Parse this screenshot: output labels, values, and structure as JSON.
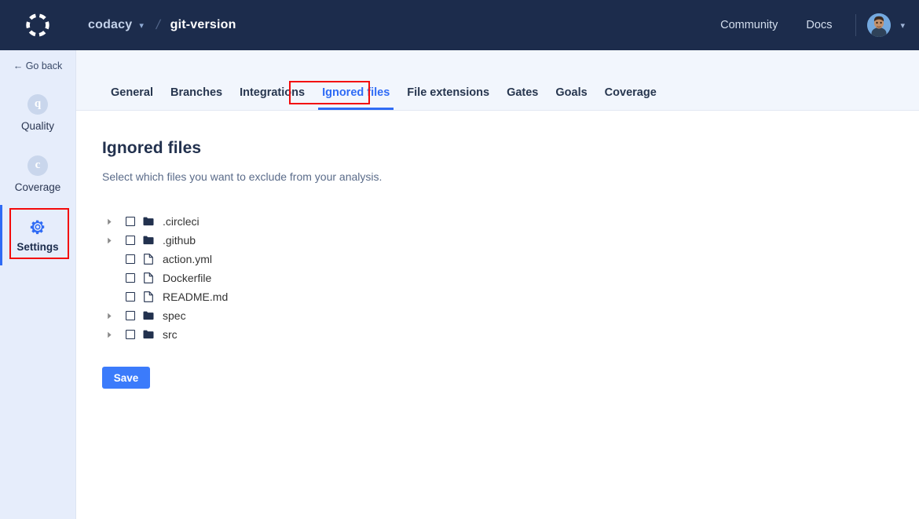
{
  "header": {
    "logo_name": "codacy-logo",
    "org": "codacy",
    "separator": "/",
    "repo": "git-version",
    "links": [
      {
        "label": "Community",
        "name": "community-link"
      },
      {
        "label": "Docs",
        "name": "docs-link"
      }
    ],
    "avatar_name": "user-avatar"
  },
  "sidebar": {
    "go_back": "← Go back",
    "items": [
      {
        "label": "Quality",
        "icon": "q",
        "active": false
      },
      {
        "label": "Coverage",
        "icon": "c",
        "active": false
      },
      {
        "label": "Settings",
        "icon": "gear-icon",
        "active": true
      }
    ]
  },
  "tabs": [
    {
      "label": "General",
      "active": false
    },
    {
      "label": "Branches",
      "active": false
    },
    {
      "label": "Integrations",
      "active": false
    },
    {
      "label": "Ignored files",
      "active": true
    },
    {
      "label": "File extensions",
      "active": false
    },
    {
      "label": "Gates",
      "active": false
    },
    {
      "label": "Goals",
      "active": false
    },
    {
      "label": "Coverage",
      "active": false
    }
  ],
  "main": {
    "title": "Ignored files",
    "subtitle": "Select which files you want to exclude from your analysis.",
    "save_label": "Save",
    "tree": [
      {
        "name": ".circleci",
        "type": "folder",
        "expandable": true,
        "checked": false
      },
      {
        "name": ".github",
        "type": "folder",
        "expandable": true,
        "checked": false
      },
      {
        "name": "action.yml",
        "type": "file",
        "expandable": false,
        "checked": false
      },
      {
        "name": "Dockerfile",
        "type": "file",
        "expandable": false,
        "checked": false
      },
      {
        "name": "README.md",
        "type": "file",
        "expandable": false,
        "checked": false
      },
      {
        "name": "spec",
        "type": "folder",
        "expandable": true,
        "checked": false
      },
      {
        "name": "src",
        "type": "folder",
        "expandable": true,
        "checked": false
      }
    ]
  },
  "colors": {
    "topbar": "#1C2C4C",
    "sidebar": "#E6EDFB",
    "accent": "#2F6BF5",
    "save_button": "#3B7BFB",
    "highlight_box": "#F30A0A",
    "tab_band": "#F2F6FD"
  }
}
